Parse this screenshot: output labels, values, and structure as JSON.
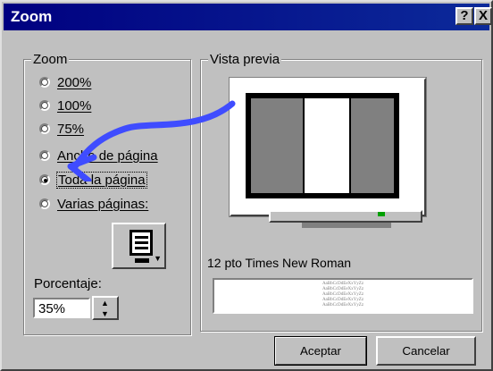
{
  "window": {
    "title": "Zoom",
    "help_label": "?",
    "close_label": "X"
  },
  "zoom": {
    "group_label": "Zoom",
    "options": [
      {
        "label": "200%",
        "selected": false
      },
      {
        "label": "100%",
        "selected": false
      },
      {
        "label": "75%",
        "selected": false
      },
      {
        "label": "Ancho de página",
        "selected": false
      },
      {
        "label": "Toda la página",
        "selected": true
      },
      {
        "label": "Varias páginas:",
        "selected": false
      }
    ],
    "multi_page_icon": "pages-picker-icon",
    "percentage_label": "Porcentaje:",
    "percentage_value": "35%"
  },
  "preview": {
    "group_label": "Vista previa",
    "font_label": "12 pto Times New Roman",
    "sample_lines": [
      "AaBbCcDdEeXxYyZz",
      "AaBbCcDdEeXxYyZz",
      "AaBbCcDdEeXxYyZz",
      "AaBbCcDdEeXxYyZz",
      "AaBbCcDdEeXxYyZz"
    ]
  },
  "buttons": {
    "accept": "Aceptar",
    "cancel": "Cancelar"
  },
  "annotation": {
    "icon": "blue-arrow-icon",
    "color": "#3f4cff"
  }
}
